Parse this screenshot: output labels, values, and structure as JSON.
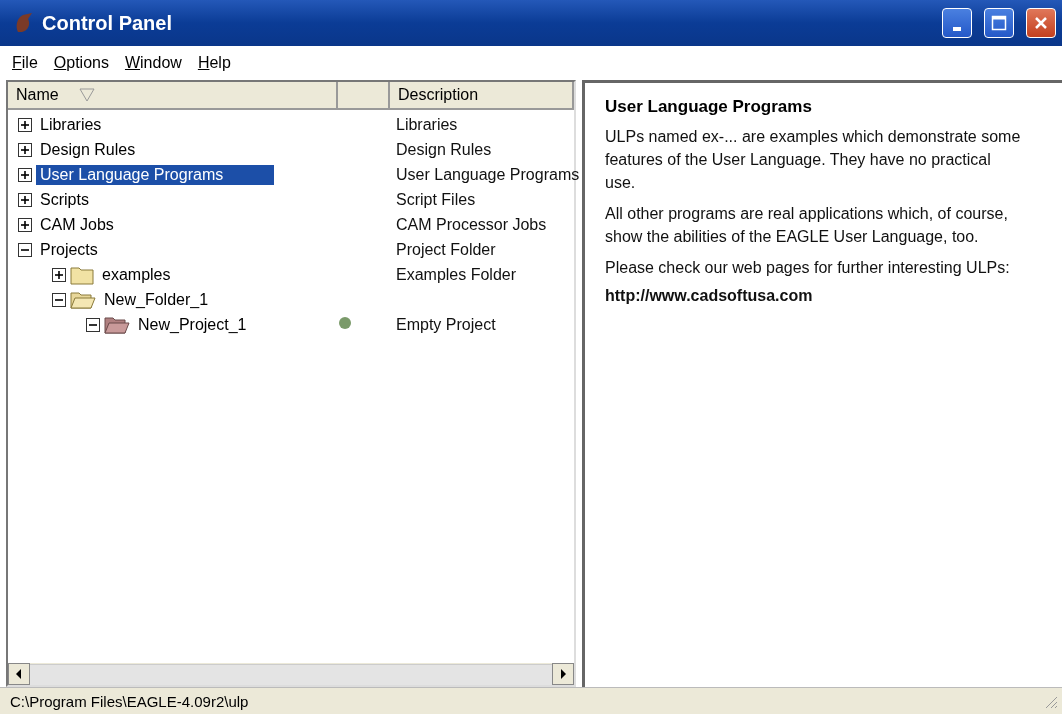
{
  "window": {
    "title": "Control Panel"
  },
  "menu": [
    "File",
    "Options",
    "Window",
    "Help"
  ],
  "tree": {
    "columns": [
      "Name",
      "Description"
    ],
    "items": [
      {
        "label": "Libraries",
        "description": "Libraries",
        "expanded": false,
        "selected": false
      },
      {
        "label": "Design Rules",
        "description": "Design Rules",
        "expanded": false,
        "selected": false
      },
      {
        "label": "User Language Programs",
        "description": "User Language Programs",
        "expanded": false,
        "selected": true
      },
      {
        "label": "Scripts",
        "description": "Script Files",
        "expanded": false,
        "selected": false
      },
      {
        "label": "CAM Jobs",
        "description": "CAM Processor Jobs",
        "expanded": false,
        "selected": false
      },
      {
        "label": "Projects",
        "description": "Project Folder",
        "expanded": true,
        "selected": false,
        "children": [
          {
            "label": "examples",
            "description": "Examples Folder",
            "kind": "folder",
            "expanded": false,
            "selected": false
          },
          {
            "label": "New_Folder_1",
            "kind": "folder",
            "expanded": true,
            "selected": false,
            "children": [
              {
                "label": "New_Project_1",
                "description": "Empty Project",
                "kind": "project",
                "expanded": true,
                "selected": false
              }
            ]
          }
        ]
      }
    ]
  },
  "detail": {
    "title": "User Language Programs",
    "paragraphs": [
      "ULPs named ex-... are examples which demonstrate some features of the User Language. They have no practical use.",
      "All other programs are real applications which, of course, show the abilities of the EAGLE User Language, too.",
      "Please check our web pages for further interesting ULPs:"
    ],
    "link": "http://www.cadsoftusa.com"
  },
  "status_bar": "C:\\Program Files\\EAGLE-4.09r2\\ulp"
}
